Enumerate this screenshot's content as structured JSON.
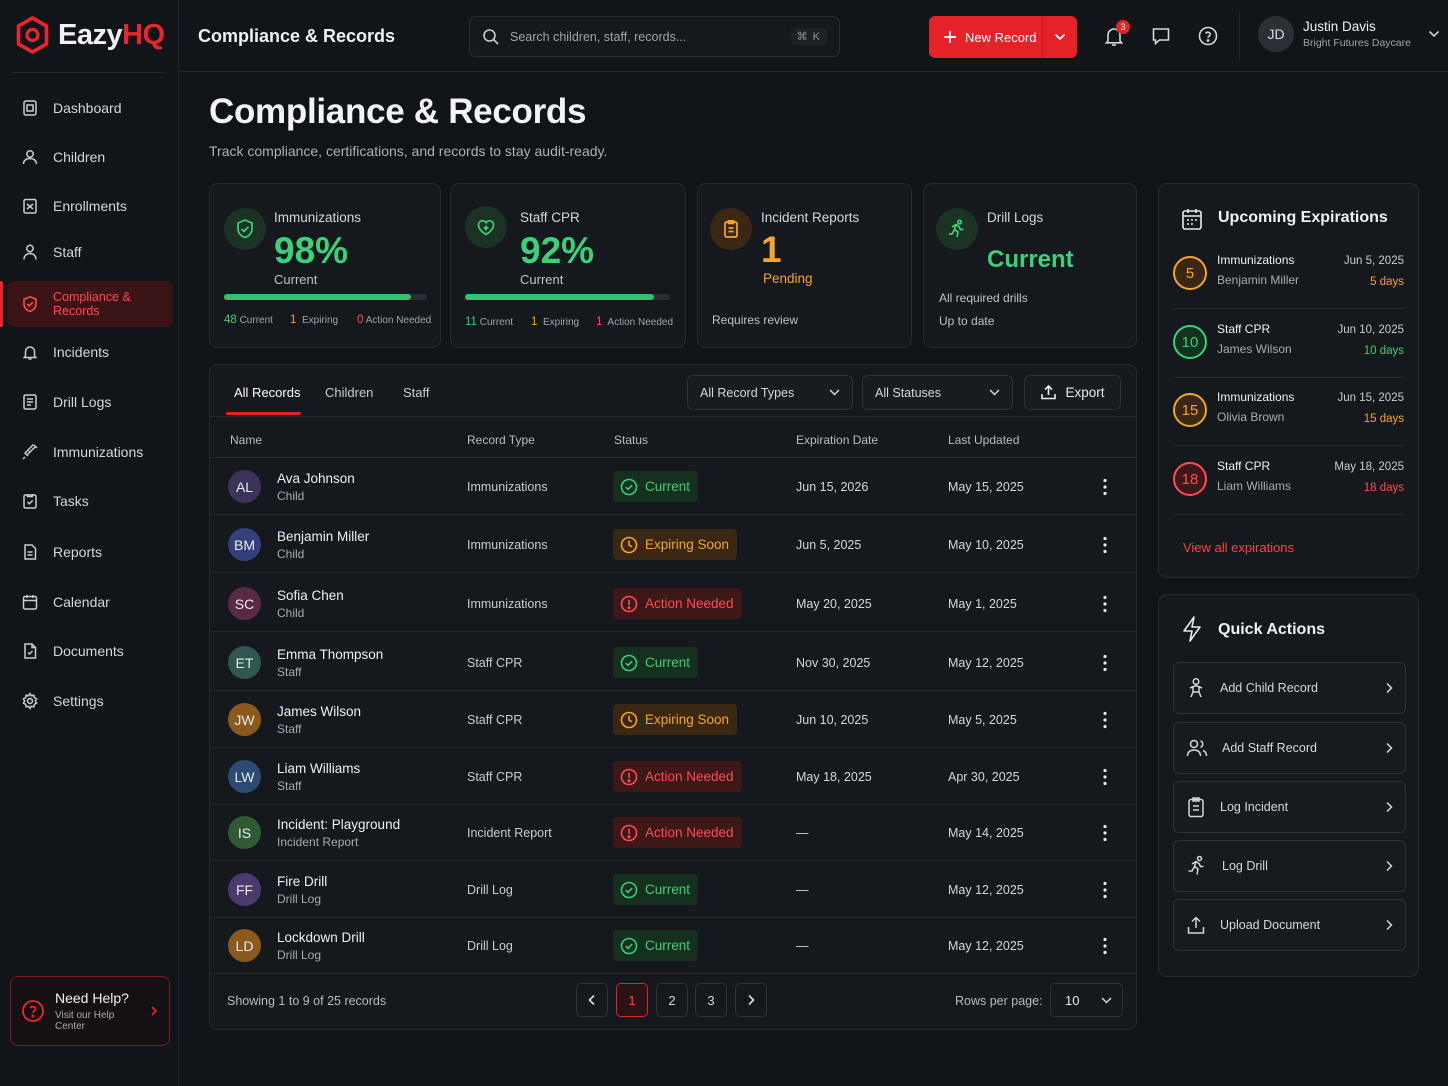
{
  "app": {
    "brand_main": "Eazy",
    "brand_accent": "HQ"
  },
  "sidebar": {
    "items": [
      {
        "label": "Dashboard",
        "icon": "dashboard-icon"
      },
      {
        "label": "Children",
        "icon": "child-icon"
      },
      {
        "label": "Enrollments",
        "icon": "clipboard-icon"
      },
      {
        "label": "Staff",
        "icon": "person-icon"
      },
      {
        "label": "Compliance & Records",
        "icon": "shield-icon",
        "active": true
      },
      {
        "label": "Incidents",
        "icon": "bell-icon"
      },
      {
        "label": "Drill Logs",
        "icon": "list-icon"
      },
      {
        "label": "Immunizations",
        "icon": "syringe-icon"
      },
      {
        "label": "Tasks",
        "icon": "task-icon"
      },
      {
        "label": "Reports",
        "icon": "report-icon"
      },
      {
        "label": "Calendar",
        "icon": "calendar-icon"
      },
      {
        "label": "Documents",
        "icon": "document-icon"
      },
      {
        "label": "Settings",
        "icon": "gear-icon"
      }
    ],
    "help": {
      "title": "Need Help?",
      "subtitle": "Visit our Help Center"
    }
  },
  "header": {
    "title": "Compliance & Records",
    "search_placeholder": "Search children, staff, records...",
    "search_shortcut": "⌘ K",
    "new_record_label": "New Record",
    "notification_count": "3",
    "user": {
      "initials": "JD",
      "name": "Justin Davis",
      "org": "Bright Futures Daycare"
    }
  },
  "page": {
    "title": "Compliance & Records",
    "subtitle": "Track compliance, certifications, and records to stay audit-ready."
  },
  "stats": {
    "immunizations": {
      "label": "Immunizations",
      "value": "98%",
      "sub": "Current",
      "progress": 0.92,
      "current_n": "48",
      "current_l": "Current",
      "expiring_n": "1",
      "expiring_l": "Expiring",
      "action_n": "0",
      "action_l": "Action Needed"
    },
    "cpr": {
      "label": "Staff CPR",
      "value": "92%",
      "sub": "Current",
      "progress": 0.92,
      "current_n": "11",
      "current_l": "Current",
      "expiring_n": "1",
      "expiring_l": "Expiring",
      "action_n": "1",
      "action_l": "Action Needed"
    },
    "incidents": {
      "label": "Incident Reports",
      "value": "1",
      "sub": "Pending",
      "note": "Requires review"
    },
    "drills": {
      "label": "Drill Logs",
      "value": "Current",
      "note1": "All required drills",
      "note2": "Up to date"
    }
  },
  "table": {
    "tabs": [
      "All Records",
      "Children",
      "Staff"
    ],
    "filter_type": "All Record Types",
    "filter_status": "All Statuses",
    "export_label": "Export",
    "columns": [
      "Name",
      "Record Type",
      "Status",
      "Expiration Date",
      "Last Updated"
    ],
    "rows": [
      {
        "initials": "AL",
        "name": "Ava Johnson",
        "sub": "Child",
        "type": "Immunizations",
        "status": "Current",
        "exp": "Jun 15, 2026",
        "updated": "May 15, 2025"
      },
      {
        "initials": "BM",
        "name": "Benjamin Miller",
        "sub": "Child",
        "type": "Immunizations",
        "status": "Expiring Soon",
        "exp": "Jun 5, 2025",
        "updated": "May 10, 2025"
      },
      {
        "initials": "SC",
        "name": "Sofia Chen",
        "sub": "Child",
        "type": "Immunizations",
        "status": "Action Needed",
        "exp": "May 20, 2025",
        "updated": "May 1, 2025"
      },
      {
        "initials": "ET",
        "name": "Emma Thompson",
        "sub": "Staff",
        "type": "Staff CPR",
        "status": "Current",
        "exp": "Nov 30, 2025",
        "updated": "May 12, 2025"
      },
      {
        "initials": "JW",
        "name": "James Wilson",
        "sub": "Staff",
        "type": "Staff CPR",
        "status": "Expiring Soon",
        "exp": "Jun 10, 2025",
        "updated": "May 5, 2025"
      },
      {
        "initials": "LW",
        "name": "Liam Williams",
        "sub": "Staff",
        "type": "Staff CPR",
        "status": "Action Needed",
        "exp": "May 18, 2025",
        "updated": "Apr 30, 2025"
      },
      {
        "initials": "IS",
        "name": "Incident: Playground",
        "sub": "Incident Report",
        "type": "Incident Report",
        "status": "Action Needed",
        "exp": "—",
        "updated": "May 14, 2025"
      },
      {
        "initials": "FF",
        "name": "Fire Drill",
        "sub": "Drill Log",
        "type": "Drill Log",
        "status": "Current",
        "exp": "—",
        "updated": "May 12, 2025"
      },
      {
        "initials": "LD",
        "name": "Lockdown Drill",
        "sub": "Drill Log",
        "type": "Drill Log",
        "status": "Current",
        "exp": "—",
        "updated": "May 12, 2025"
      }
    ],
    "showing": "Showing 1 to 9 of 25 records",
    "pages": [
      "1",
      "2",
      "3"
    ],
    "rows_per_page_label": "Rows per page:",
    "rows_per_page": "10"
  },
  "expirations": {
    "title": "Upcoming Expirations",
    "items": [
      {
        "days_n": "5",
        "type": "Immunizations",
        "name": "Benjamin Miller",
        "date": "Jun 5, 2025",
        "days": "5 days",
        "color": "#f6a42a"
      },
      {
        "days_n": "10",
        "type": "Staff CPR",
        "name": "James Wilson",
        "date": "Jun 10, 2025",
        "days": "10 days",
        "color": "#3ad17a"
      },
      {
        "days_n": "15",
        "type": "Immunizations",
        "name": "Olivia Brown",
        "date": "Jun 15, 2025",
        "days": "15 days",
        "color": "#f6a42a"
      },
      {
        "days_n": "18",
        "type": "Staff CPR",
        "name": "Liam Williams",
        "date": "May 18, 2025",
        "days": "18 days",
        "color": "#ff4d52"
      }
    ],
    "view_all": "View all expirations"
  },
  "quick_actions": {
    "title": "Quick Actions",
    "items": [
      "Add Child Record",
      "Add Staff Record",
      "Log Incident",
      "Log Drill",
      "Upload Document"
    ]
  },
  "colors": {
    "accent": "#e42228",
    "success": "#3ad17a",
    "warning": "#f6a42a",
    "danger": "#ff4d52"
  }
}
